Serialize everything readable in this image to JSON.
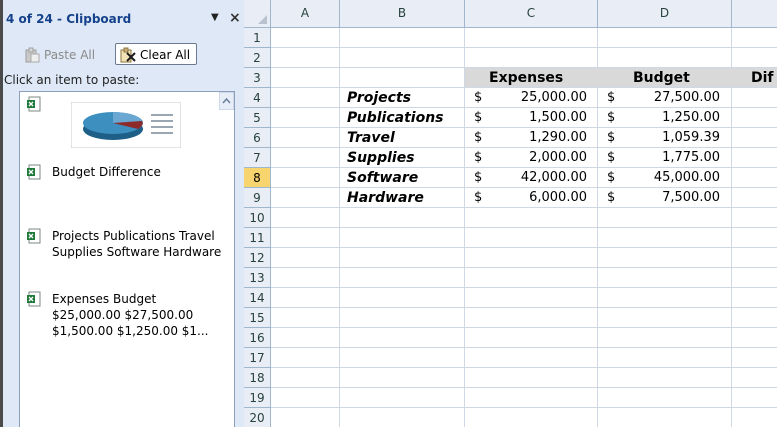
{
  "pane": {
    "title": "4 of 24 - Clipboard",
    "dropdown_glyph": "▼",
    "close_glyph": "×",
    "paste_all_label": "Paste All",
    "clear_all_label": "Clear All",
    "hint": "Click an item to paste:",
    "items": [
      {
        "type": "chart",
        "icon": "excel-clip-icon"
      },
      {
        "type": "text",
        "icon": "excel-clip-icon",
        "text": "Budget Difference"
      },
      {
        "type": "text",
        "icon": "excel-clip-icon",
        "text": "Projects Publications Travel Supplies Software Hardware"
      },
      {
        "type": "text",
        "icon": "excel-clip-icon",
        "text": "Expenses Budget $25,000.00 $27,500.00 $1,500.00 $1,250.00 $1..."
      }
    ]
  },
  "sheet": {
    "columns": [
      "A",
      "B",
      "C",
      "D"
    ],
    "rows": [
      "1",
      "2",
      "3",
      "4",
      "5",
      "6",
      "7",
      "8",
      "9",
      "10",
      "11",
      "12",
      "13",
      "14",
      "15",
      "16",
      "17",
      "18",
      "19",
      "20"
    ],
    "selected_row": "8",
    "headers": {
      "expenses": "Expenses",
      "budget": "Budget",
      "difference": "Dif"
    },
    "currency": "$",
    "data": [
      {
        "category": "Projects",
        "expenses": "25,000.00",
        "budget": "27,500.00"
      },
      {
        "category": "Publications",
        "expenses": "1,500.00",
        "budget": "1,250.00"
      },
      {
        "category": "Travel",
        "expenses": "1,290.00",
        "budget": "1,059.39"
      },
      {
        "category": "Supplies",
        "expenses": "2,000.00",
        "budget": "1,775.00"
      },
      {
        "category": "Software",
        "expenses": "42,000.00",
        "budget": "45,000.00"
      },
      {
        "category": "Hardware",
        "expenses": "6,000.00",
        "budget": "7,500.00"
      }
    ]
  },
  "colors": {
    "header_fill": "#d9d9d9",
    "selected_row_header": "#f8d46e",
    "pane_bg": "#dfe8f6",
    "pane_title": "#15428b"
  }
}
